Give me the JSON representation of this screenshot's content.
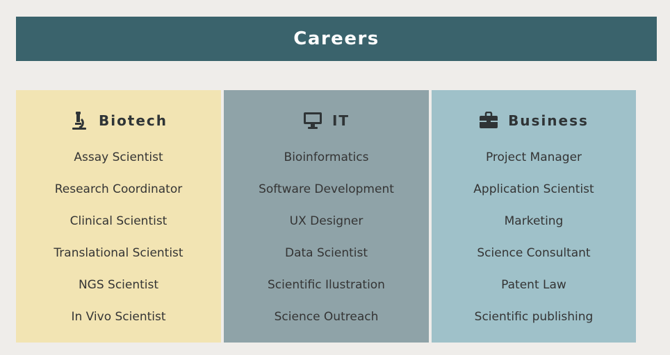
{
  "banner": {
    "title": "Careers"
  },
  "columns": [
    {
      "title": "Biotech",
      "icon": "microscope-icon",
      "color": "#f2e4b3",
      "items": [
        "Assay Scientist",
        "Research Coordinator",
        "Clinical Scientist",
        "Translational Scientist",
        "NGS Scientist",
        "In Vivo Scientist"
      ]
    },
    {
      "title": "IT",
      "icon": "monitor-icon",
      "color": "#8fa3a8",
      "items": [
        "Bioinformatics",
        "Software Development",
        "UX Designer",
        "Data Scientist",
        "Scientific Ilustration",
        "Science Outreach"
      ]
    },
    {
      "title": "Business",
      "icon": "briefcase-icon",
      "color": "#9fc1c9",
      "items": [
        "Project Manager",
        "Application Scientist",
        "Marketing",
        "Science Consultant",
        "Patent Law",
        "Scientific publishing"
      ]
    }
  ],
  "colors": {
    "banner": "#3a636c",
    "background": "#efedea"
  }
}
